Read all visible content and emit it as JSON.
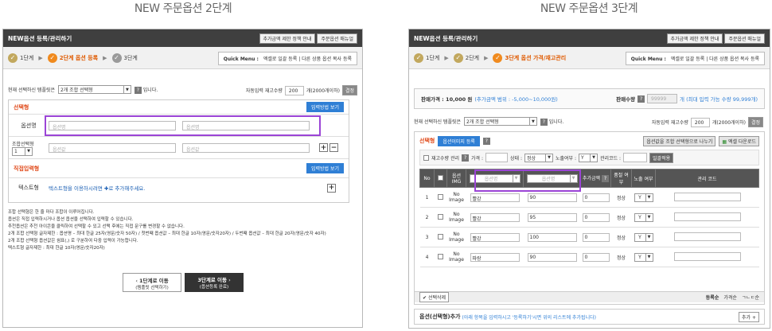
{
  "titles": {
    "left": "NEW 주문옵션 2단계",
    "right": "NEW 주문옵션 3단계"
  },
  "header": {
    "title": "NEW옵션 등록/관리하기",
    "btn_policy": "추가금액 제한 정책 안내",
    "btn_manual": "주문옵션 매뉴얼"
  },
  "steps": {
    "s1": "1단계",
    "s2_p2": "2단계 옵션 등록",
    "s2_p3": "2단계",
    "s3_p2": "3단계",
    "s3_p3": "3단계 옵션 가격/재고관리"
  },
  "quick": {
    "label": "Quick Menu :",
    "item1": "엑셀로 일괄 등록",
    "sep": "|",
    "item2": "다른 상품 옵션 복사 등록"
  },
  "template": {
    "prefix": "현재 선택하신 템플릿은",
    "value": "2개 조합 선택형",
    "suffix": "입니다.",
    "auto_label": "자동입력 재고수량",
    "auto_value": "200",
    "auto_note": "개(2000개이하)",
    "apply": "결정"
  },
  "p2": {
    "select_title": "선택형",
    "input_help": "입력방법 보기",
    "option_name_label": "옵션명",
    "name1_ph": "옵션명",
    "name2_ph": "옵션명",
    "combo_label": "조합선택형",
    "combo_value": "1",
    "value1_ph": "옵션값",
    "value2_ph": "옵션값",
    "direct_title": "직접입력형",
    "direct_help": "입력방법 보기",
    "text_label": "텍스트형",
    "text_desc": "텍스트형을 이용하시려면 ✚로 추가해주세요.",
    "notes": [
      "조합 선택형은 한 줄 마다 조합이 이루어집니다.",
      "옵션은 직접 입력하시거나 옵션 옵션을 선택하여 입력할 수 있습니다.",
      "추천옵션은 추천 아이콘을 클릭하여 선택할 수 있고 선택 후에는 직접 문구를 변경할 수 없습니다.",
      "2개 조합 선택형 글자제한 : 옵션명 – 최대 한글 25자(영문/숫자 50자) / 첫번째 옵션값 – 최대 한글 10자(영문/숫자20자) / 두번째 옵션값 – 최대 한글 20자(영문/숫자 40자)",
      "2개 조합 선택형 옵션값은 쉼표(,) 로 구분하여 다중 입력이 가능합니다.",
      "텍스트형 글자제한 : 최대 한글 10자(영문/숫자20자)"
    ],
    "prev_btn": "1단계로 이동",
    "prev_sub": "(템플릿 선택하기)",
    "next_btn": "3단계로 이동",
    "next_sub": "(옵션등록 완료)"
  },
  "p3": {
    "price_label": "판매가격 : 10,000 원",
    "price_range": "(추가금액 범위 : -5,000~10,000원)",
    "qty_label": "판매수량",
    "qty_value": "99999",
    "qty_note": "개 (최대 입력 가능 수량 99,999개)",
    "select_title": "선택형",
    "img_btn": "옵션이미지 등록",
    "combine_btn": "옵션값을 조합 선택형으로 나누기",
    "excel_btn": "엑셀 다운로드",
    "filter": {
      "stock_label": "재고수량 관리",
      "price_label": "가격 :",
      "state_label": "상태 :",
      "state_value": "정상",
      "expose_label": "노출여부 :",
      "expose_value": "Y",
      "code_label": "관리코드 :",
      "apply": "일괄적용"
    },
    "columns": [
      "No",
      "",
      "옵션 IMG",
      "옵션명",
      "옵션명",
      "추가금액",
      "품절 여부",
      "노출 여부",
      "관리 코드"
    ],
    "rows": [
      {
        "no": "1",
        "img": "No Image",
        "c1": "빨강",
        "c2": "90",
        "add": "0",
        "state": "정상",
        "expose": "Y"
      },
      {
        "no": "2",
        "img": "No Image",
        "c1": "빨강",
        "c2": "95",
        "add": "0",
        "state": "정상",
        "expose": "Y"
      },
      {
        "no": "3",
        "img": "No Image",
        "c1": "빨강",
        "c2": "100",
        "add": "0",
        "state": "정상",
        "expose": "Y"
      },
      {
        "no": "4",
        "img": "No Image",
        "c1": "파랑",
        "c2": "90",
        "add": "0",
        "state": "정상",
        "expose": "Y"
      }
    ],
    "delete_btn": "선택삭제",
    "sort": {
      "a": "등록순",
      "b": "가격순",
      "c": "ㄱㄴㄷ순"
    },
    "footer_title": "옵션(선택형)추가",
    "footer_note": "(아래 항목을 입력하시고 '등록하기'시면 위의 리스트에 추가됩니다)",
    "add_btn": "추가"
  }
}
